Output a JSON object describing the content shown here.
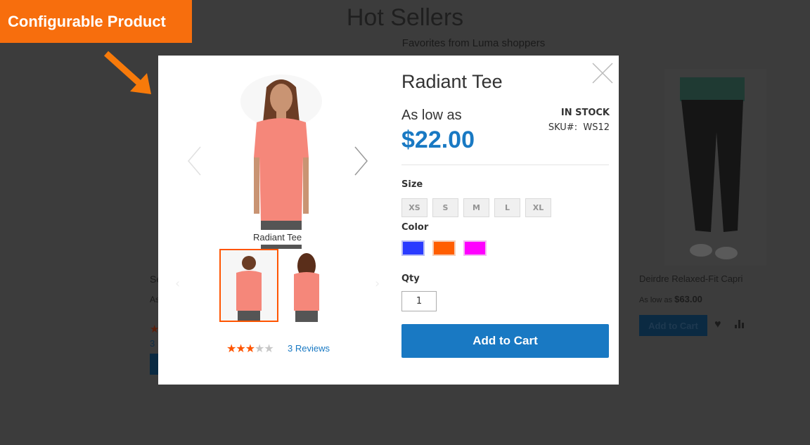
{
  "annotation": {
    "label": "Configurable Product",
    "color": "#f76e0d"
  },
  "background": {
    "title": "Hot Sellers",
    "subtitle": "Favorites from Luma shoppers",
    "left_product": {
      "name": "Se",
      "price_prefix": "As",
      "review_count": "3"
    },
    "right_product": {
      "name": "Deirdre Relaxed-Fit Capri",
      "price_prefix": "As low as",
      "price": "$63.00",
      "add_to_cart": "Add to Cart"
    }
  },
  "modal": {
    "title": "Radiant Tee",
    "price_prefix": "As low as",
    "price": "$22.00",
    "stock": "IN STOCK",
    "sku_label": "SKU#:",
    "sku": "WS12",
    "size_label": "Size",
    "sizes": [
      "XS",
      "S",
      "M",
      "L",
      "XL"
    ],
    "color_label": "Color",
    "colors": [
      "#2a3bff",
      "#ff5e00",
      "#ff00ff"
    ],
    "qty_label": "Qty",
    "qty": "1",
    "add_to_cart": "Add to Cart",
    "image_caption": "Radiant Tee",
    "rating": 3,
    "rating_max": 5,
    "reviews": "3 Reviews",
    "accent": "#1979c3"
  }
}
